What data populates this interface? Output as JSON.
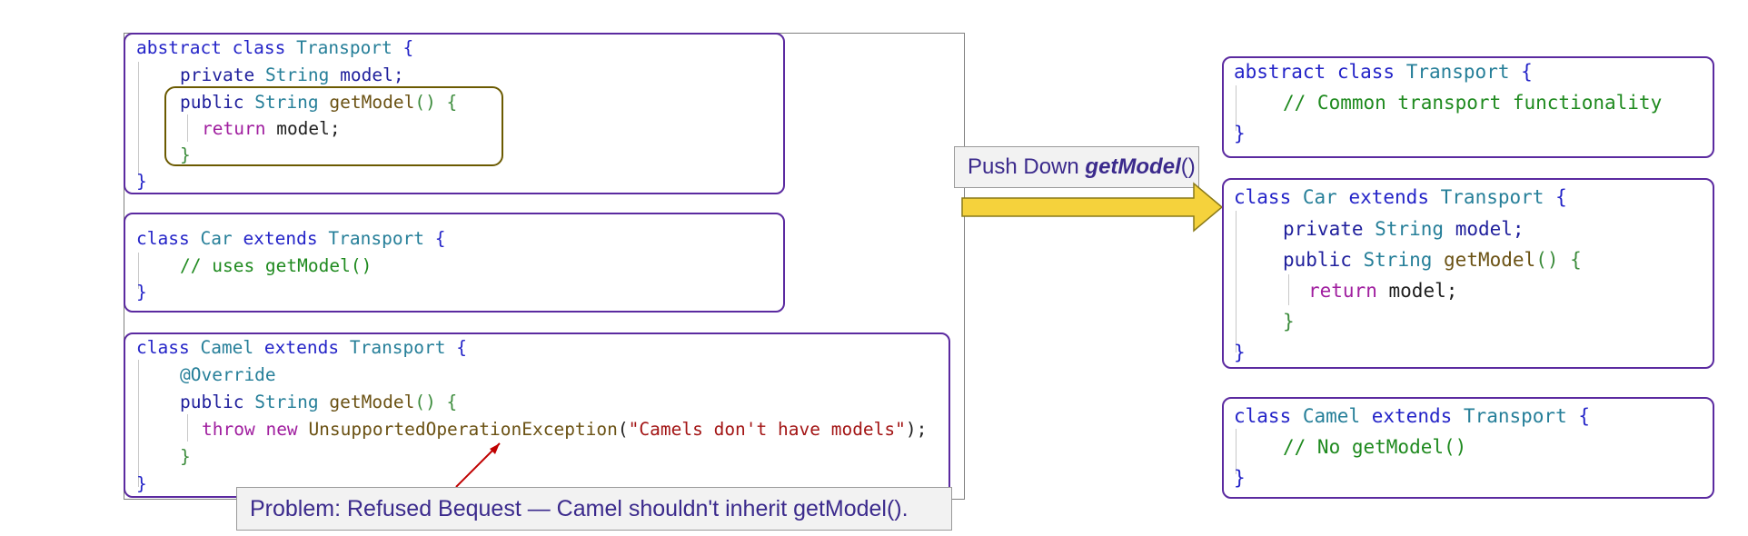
{
  "colors": {
    "box_border": "#5b2aa0",
    "method_border": "#6b5a00",
    "arrow_fill": "#f5d23c",
    "keyword": "#2424c8",
    "type": "#267f99",
    "function": "#6b5214",
    "comment": "#1f8a1f",
    "return_kw": "#a01e9f",
    "string": "#a31515",
    "label_text": "#3b2a8c",
    "callout_line": "#c00000"
  },
  "before": {
    "transport": {
      "l1": {
        "kw1": "abstract",
        "kw2": "class",
        "type": "Transport",
        "brace": "{"
      },
      "l2": {
        "kw": "private",
        "type": "String",
        "name": "model;"
      },
      "l3": {
        "kw": "public",
        "type": "String",
        "fn": "getModel",
        "paren": "() {"
      },
      "l4": {
        "kw": "return",
        "rest": "model;"
      },
      "l5": "}",
      "l6": "}"
    },
    "car": {
      "l1": {
        "kw1": "class",
        "type": "Car",
        "kw2": "extends",
        "type2": "Transport",
        "brace": "{"
      },
      "l2": "// uses getModel()",
      "l3": "}"
    },
    "camel": {
      "l1": {
        "kw1": "class",
        "type": "Camel",
        "kw2": "extends",
        "type2": "Transport",
        "brace": "{"
      },
      "l2": "@Override",
      "l3": {
        "kw": "public",
        "type": "String",
        "fn": "getModel",
        "paren": "() {"
      },
      "l4": {
        "kw1": "throw",
        "kw2": "new",
        "fn": "UnsupportedOperationException",
        "open": "(",
        "str": "\"Camels don't have models\"",
        "close": ");"
      },
      "l5": "}",
      "l6": "}"
    },
    "problem_label": "Problem: Refused Bequest — Camel shouldn't inherit getModel()."
  },
  "refactor": {
    "prefix": "Push Down ",
    "method": "getModel",
    "suffix": "()"
  },
  "after": {
    "transport": {
      "l1": {
        "kw1": "abstract",
        "kw2": "class",
        "type": "Transport",
        "brace": "{"
      },
      "l2": "// Common transport functionality",
      "l3": "}"
    },
    "car": {
      "l1": {
        "kw1": "class",
        "type": "Car",
        "kw2": "extends",
        "type2": "Transport",
        "brace": "{"
      },
      "l2": {
        "kw": "private",
        "type": "String",
        "name": "model;"
      },
      "l3": {
        "kw": "public",
        "type": "String",
        "fn": "getModel",
        "paren": "() {"
      },
      "l4": {
        "kw": "return",
        "rest": "model;"
      },
      "l5": "}",
      "l6": "}"
    },
    "camel": {
      "l1": {
        "kw1": "class",
        "type": "Camel",
        "kw2": "extends",
        "type2": "Transport",
        "brace": "{"
      },
      "l2": "// No getModel()",
      "l3": "}"
    }
  }
}
